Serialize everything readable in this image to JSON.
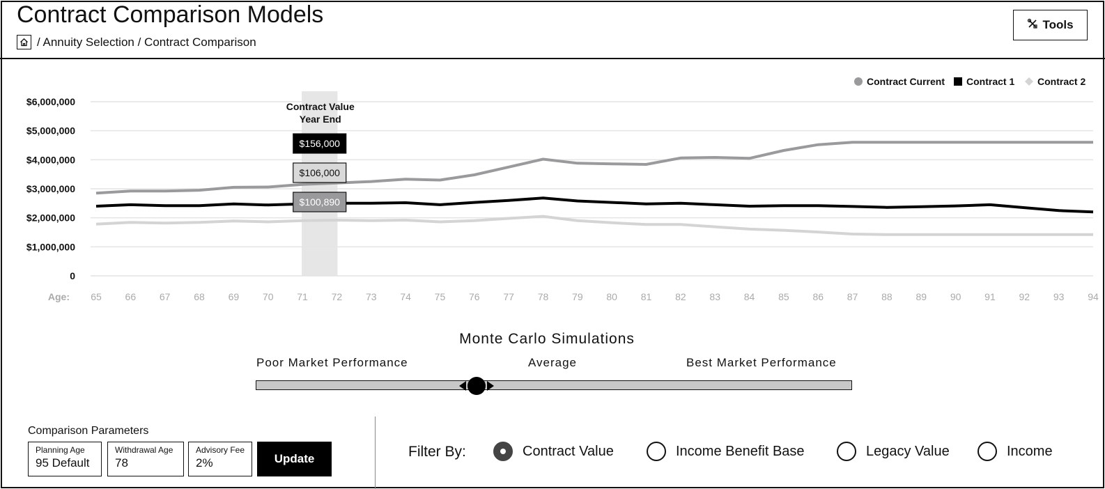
{
  "header": {
    "title": "Contract Comparison Models",
    "breadcrumb": "/ Annuity Selection / Contract Comparison",
    "tools_label": "Tools"
  },
  "chart_data": {
    "type": "line",
    "x_label": "Age:",
    "x": [
      65,
      66,
      67,
      68,
      69,
      70,
      71,
      72,
      73,
      74,
      75,
      76,
      77,
      78,
      79,
      80,
      81,
      82,
      83,
      84,
      85,
      86,
      87,
      88,
      89,
      90,
      91,
      92,
      93,
      94
    ],
    "y_ticks": [
      "$6,000,000",
      "$5,000,000",
      "$4,000,000",
      "$3,000,000",
      "$2,000,000",
      "$1,000,000",
      "0"
    ],
    "ylim": [
      0,
      6000000
    ],
    "grid": true,
    "legend_position": "top-right",
    "series": [
      {
        "name": "Contract Current",
        "color": "#9a9a9c",
        "marker": "circle",
        "values": [
          2850000,
          2920000,
          2920000,
          2950000,
          3050000,
          3060000,
          3150000,
          3200000,
          3250000,
          3330000,
          3300000,
          3480000,
          3750000,
          4020000,
          3880000,
          3860000,
          3840000,
          4060000,
          4080000,
          4050000,
          4320000,
          4520000,
          4600000,
          4600000,
          4600000,
          4600000,
          4600000,
          4600000,
          4600000,
          4600000
        ]
      },
      {
        "name": "Contract 1",
        "color": "#000000",
        "marker": "square",
        "values": [
          2400000,
          2450000,
          2420000,
          2420000,
          2480000,
          2440000,
          2480000,
          2500000,
          2500000,
          2520000,
          2450000,
          2530000,
          2600000,
          2680000,
          2580000,
          2530000,
          2480000,
          2500000,
          2450000,
          2400000,
          2420000,
          2420000,
          2390000,
          2360000,
          2380000,
          2410000,
          2450000,
          2350000,
          2250000,
          2200000
        ]
      },
      {
        "name": "Contract 2",
        "color": "#d4d4d4",
        "marker": "diamond",
        "values": [
          1780000,
          1840000,
          1820000,
          1840000,
          1890000,
          1860000,
          1900000,
          1920000,
          1900000,
          1920000,
          1860000,
          1900000,
          1980000,
          2050000,
          1900000,
          1830000,
          1770000,
          1770000,
          1690000,
          1610000,
          1570000,
          1510000,
          1440000,
          1420000,
          1420000,
          1420000,
          1420000,
          1420000,
          1420000,
          1420000
        ]
      }
    ],
    "highlight": {
      "range": [
        71,
        72
      ],
      "label_line1": "Contract Value",
      "label_line2": "Year End",
      "values": [
        {
          "text": "$156,000",
          "bg": "#000000",
          "fg": "#ffffff"
        },
        {
          "text": "$106,000",
          "bg": "#d9d9d9",
          "fg": "#111111"
        },
        {
          "text": "$100,890",
          "bg": "#9a9a9c",
          "fg": "#ffffff"
        }
      ]
    }
  },
  "monte_carlo": {
    "title": "Monte Carlo Simulations",
    "poor": "Poor Market Performance",
    "average": "Average",
    "best": "Best Market Performance",
    "position": 0.37
  },
  "params": {
    "title": "Comparison Parameters",
    "planning_age_label": "Planning Age",
    "planning_age_value": "95 Default",
    "withdrawal_age_label": "Withdrawal Age",
    "withdrawal_age_value": "78",
    "advisory_fee_label": "Advisory Fee",
    "advisory_fee_value": "2%",
    "update_label": "Update"
  },
  "filter": {
    "label": "Filter By:",
    "options": [
      "Contract Value",
      "Income Benefit Base",
      "Legacy Value",
      "Income"
    ],
    "selected": "Contract Value"
  }
}
